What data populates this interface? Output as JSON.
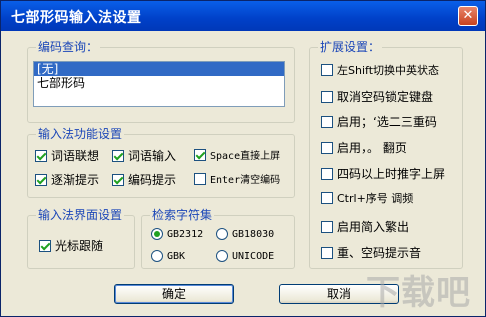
{
  "window": {
    "title": "七部形码输入法设置",
    "close_label": "✕"
  },
  "code_query": {
    "label": "编码查询：",
    "items": [
      "[无]",
      "七部形码"
    ],
    "selected_index": 0
  },
  "function_settings": {
    "label": "输入法功能设置",
    "options": [
      {
        "label": "词语联想",
        "checked": true
      },
      {
        "label": "词语输入",
        "checked": true
      },
      {
        "label": "Space直接上屏",
        "checked": true
      },
      {
        "label": "逐渐提示",
        "checked": true
      },
      {
        "label": "编码提示",
        "checked": true
      },
      {
        "label": "Enter清空编码",
        "checked": false
      }
    ]
  },
  "ui_settings": {
    "label": "输入法界面设置",
    "options": [
      {
        "label": "光标跟随",
        "checked": true
      }
    ]
  },
  "charset": {
    "label": "检索字符集",
    "options": [
      {
        "label": "GB2312",
        "selected": true
      },
      {
        "label": "GB18030",
        "selected": false
      },
      {
        "label": "GBK",
        "selected": false
      },
      {
        "label": "UNICODE",
        "selected": false
      }
    ]
  },
  "extended": {
    "label": "扩展设置：",
    "options": [
      {
        "label": "左Shift切换中英状态",
        "checked": false
      },
      {
        "label": "取消空码锁定键盘",
        "checked": false
      },
      {
        "label": "启用；‘选二三重码",
        "checked": false
      },
      {
        "label": "启用，。 翻页",
        "checked": false
      },
      {
        "label": "四码以上时推字上屏",
        "checked": false
      },
      {
        "label": "Ctrl+序号 调频",
        "checked": false
      },
      {
        "label": "启用简入繁出",
        "checked": false
      },
      {
        "label": "重、空码提示音",
        "checked": false
      }
    ]
  },
  "buttons": {
    "ok": "确定",
    "cancel": "取消"
  },
  "watermark": "下载吧"
}
